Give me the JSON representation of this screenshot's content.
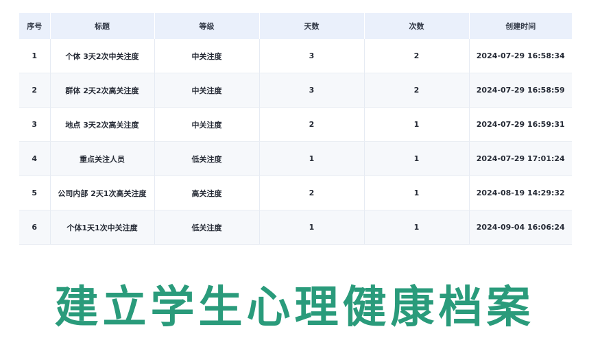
{
  "table": {
    "headers": {
      "seq": "序号",
      "title": "标题",
      "level": "等级",
      "days": "天数",
      "times": "次数",
      "created": "创建时间"
    },
    "rows": [
      {
        "seq": "1",
        "title": "个体 3天2次中关注度",
        "level": "中关注度",
        "days": "3",
        "times": "2",
        "created": "2024-07-29 16:58:34"
      },
      {
        "seq": "2",
        "title": "群体 2天2次高关注度",
        "level": "中关注度",
        "days": "3",
        "times": "2",
        "created": "2024-07-29 16:58:59"
      },
      {
        "seq": "3",
        "title": "地点 3天2次高关注度",
        "level": "中关注度",
        "days": "2",
        "times": "1",
        "created": "2024-07-29 16:59:31"
      },
      {
        "seq": "4",
        "title": "重点关注人员",
        "level": "低关注度",
        "days": "1",
        "times": "1",
        "created": "2024-07-29 17:01:24"
      },
      {
        "seq": "5",
        "title": "公司内部 2天1次高关注度",
        "level": "高关注度",
        "days": "2",
        "times": "1",
        "created": "2024-08-19 14:29:32"
      },
      {
        "seq": "6",
        "title": "个体1天1次中关注度",
        "level": "低关注度",
        "days": "1",
        "times": "1",
        "created": "2024-09-04 16:06:24"
      }
    ]
  },
  "banner": {
    "text": "建立学生心理健康档案",
    "color": "#2a9b7b"
  },
  "colors": {
    "header_bg": "#eaf0fb",
    "stripe_bg": "#f6f8fb"
  }
}
